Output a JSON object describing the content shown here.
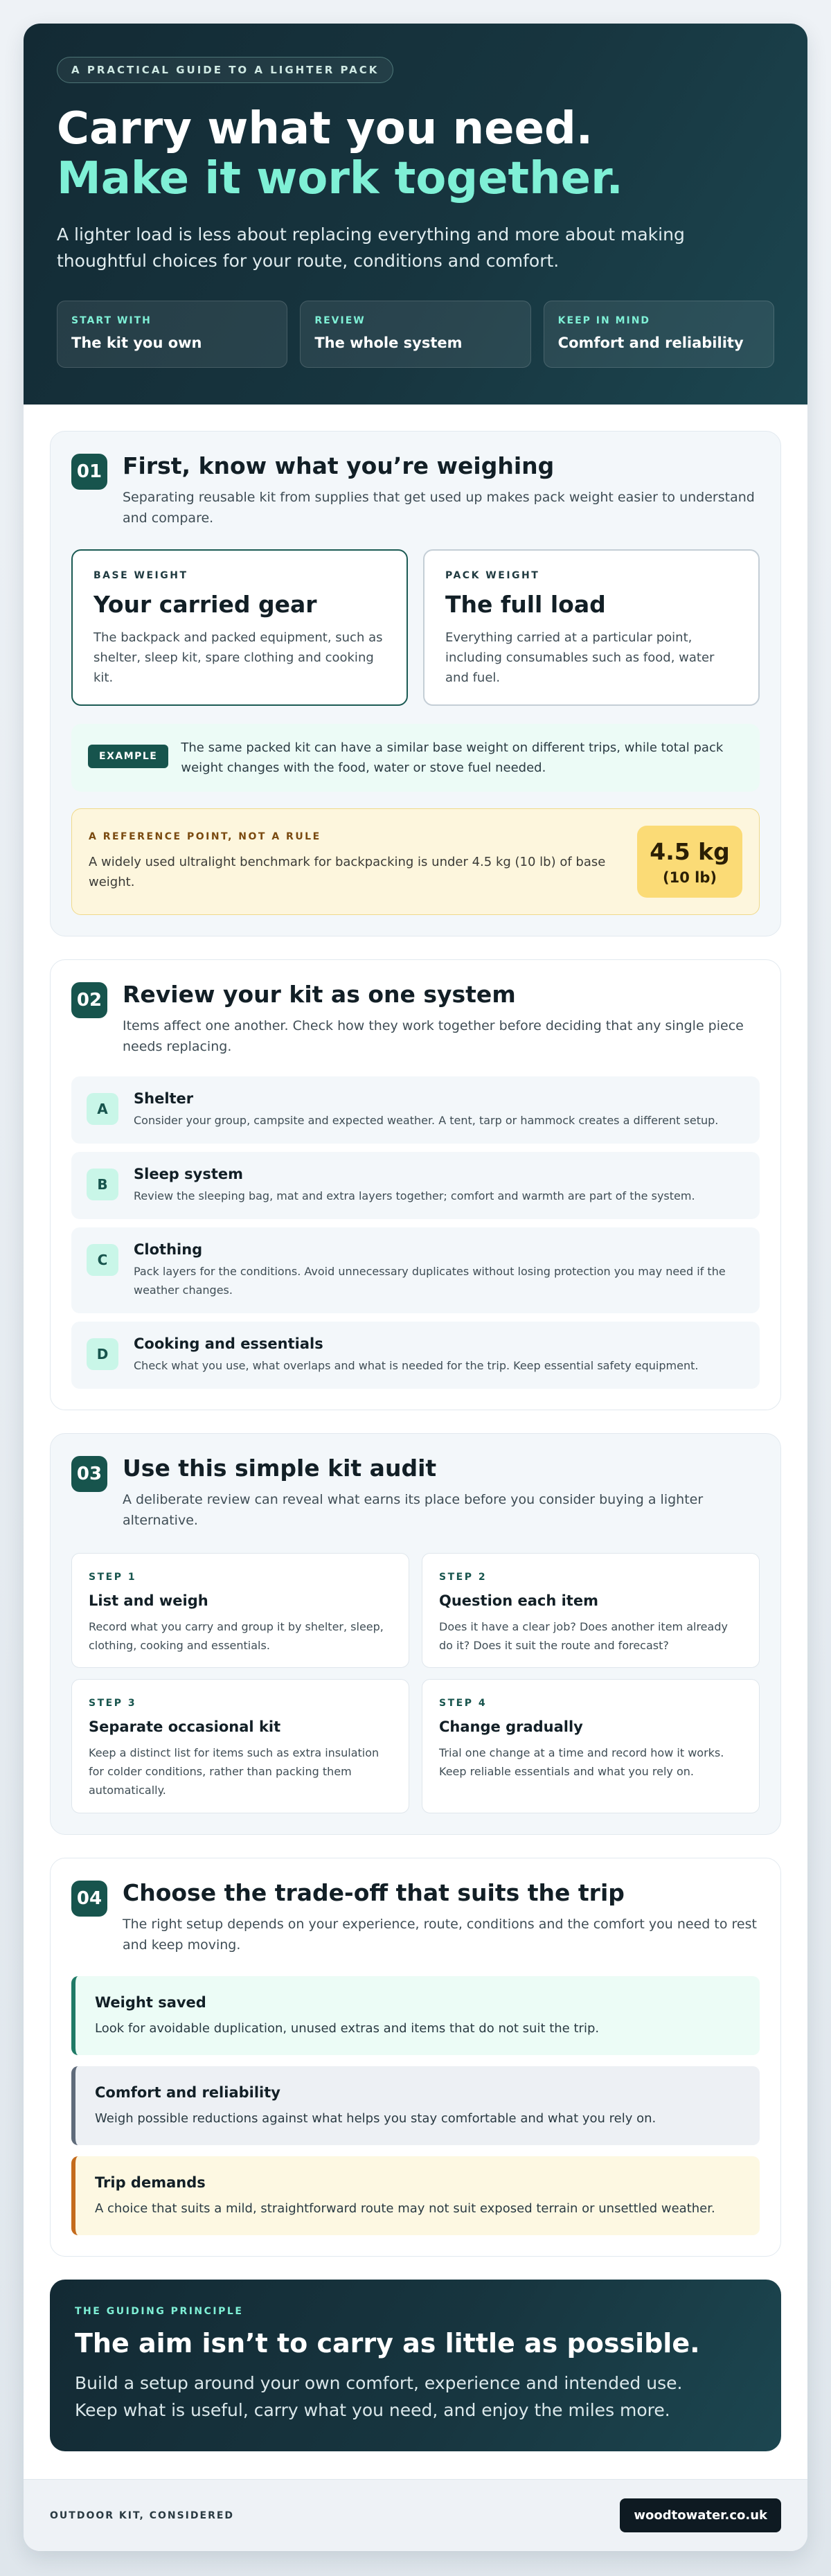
{
  "hero": {
    "eyebrow": "A PRACTICAL GUIDE TO A LIGHTER PACK",
    "title_line1": "Carry what you need.",
    "title_line2": "Make it work together.",
    "lead": "A lighter load is less about replacing everything and more about making thoughtful choices for your route, conditions and comfort.",
    "cards": [
      {
        "label": "START WITH",
        "value": "The kit you own"
      },
      {
        "label": "REVIEW",
        "value": "The whole system"
      },
      {
        "label": "KEEP IN MIND",
        "value": "Comfort and reliability"
      }
    ]
  },
  "section1": {
    "number": "01",
    "title": "First, know what you’re weighing",
    "intro": "Separating reusable kit from supplies that get used up makes pack weight easier to understand and compare.",
    "boxes": [
      {
        "label": "BASE WEIGHT",
        "title": "Your carried gear",
        "desc": "The backpack and packed equipment, such as shelter, sleep kit, spare clothing and cooking kit."
      },
      {
        "label": "PACK WEIGHT",
        "title": "The full load",
        "desc": "Everything carried at a particular point, including consumables such as food, water and fuel."
      }
    ],
    "example_tag": "EXAMPLE",
    "example_text": "The same packed kit can have a similar base weight on different trips, while total pack weight changes with the food, water or stove fuel needed.",
    "reference_label": "A REFERENCE POINT, NOT A RULE",
    "reference_text": "A widely used ultralight benchmark for backpacking is under 4.5 kg (10 lb) of base weight.",
    "reference_value": "4.5 kg",
    "reference_value_alt": "(10 lb)"
  },
  "section2": {
    "number": "02",
    "title": "Review your kit as one system",
    "intro": "Items affect one another. Check how they work together before deciding that any single piece needs replacing.",
    "items": [
      {
        "letter": "A",
        "name": "Shelter",
        "desc": "Consider your group, campsite and expected weather. A tent, tarp or hammock creates a different setup."
      },
      {
        "letter": "B",
        "name": "Sleep system",
        "desc": "Review the sleeping bag, mat and extra layers together; comfort and warmth are part of the system."
      },
      {
        "letter": "C",
        "name": "Clothing",
        "desc": "Pack layers for the conditions. Avoid unnecessary duplicates without losing protection you may need if the weather changes."
      },
      {
        "letter": "D",
        "name": "Cooking and essentials",
        "desc": "Check what you use, what overlaps and what is needed for the trip. Keep essential safety equipment."
      }
    ]
  },
  "section3": {
    "number": "03",
    "title": "Use this simple kit audit",
    "intro": "A deliberate review can reveal what earns its place before you consider buying a lighter alternative.",
    "steps": [
      {
        "label": "STEP 1",
        "title": "List and weigh",
        "desc": "Record what you carry and group it by shelter, sleep, clothing, cooking and essentials."
      },
      {
        "label": "STEP 2",
        "title": "Question each item",
        "desc": "Does it have a clear job? Does another item already do it? Does it suit the route and forecast?"
      },
      {
        "label": "STEP 3",
        "title": "Separate occasional kit",
        "desc": "Keep a distinct list for items such as extra insulation for colder conditions, rather than packing them automatically."
      },
      {
        "label": "STEP 4",
        "title": "Change gradually",
        "desc": "Trial one change at a time and record how it works. Keep reliable essentials and what you rely on."
      }
    ]
  },
  "section4": {
    "number": "04",
    "title": "Choose the trade-off that suits the trip",
    "intro": "The right setup depends on your experience, route, conditions and the comfort you need to rest and keep moving.",
    "tradeoffs": [
      {
        "title": "Weight saved",
        "desc": "Look for avoidable duplication, unused extras and items that do not suit the trip."
      },
      {
        "title": "Comfort and reliability",
        "desc": "Weigh possible reductions against what helps you stay comfortable and what you rely on."
      },
      {
        "title": "Trip demands",
        "desc": "A choice that suits a mild, straightforward route may not suit exposed terrain or unsettled weather."
      }
    ]
  },
  "principle": {
    "label": "THE GUIDING PRINCIPLE",
    "title": "The aim isn’t to carry as little as possible.",
    "line1": "Build a setup around your own comfort, experience and intended use.",
    "line2": "Keep what is useful, carry what you need, and enjoy the miles more."
  },
  "footer": {
    "brand": "OUTDOOR KIT, CONSIDERED",
    "site": "woodtowater.co.uk"
  },
  "colors": {
    "hero_bg": "#17353f",
    "accent_mint": "#7ff0d6",
    "section_number_bg": "#17544d",
    "reference_badge": "#fbdb76",
    "trade_green": "#1f7a66",
    "trade_grey": "#5f6b7a",
    "trade_amber": "#c46b1c"
  }
}
